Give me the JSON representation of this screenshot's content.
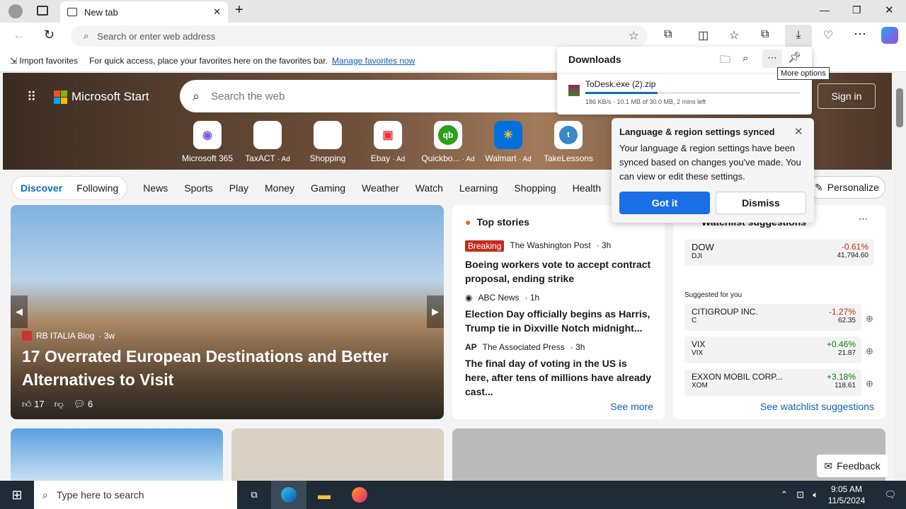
{
  "browser": {
    "tab_title": "New tab",
    "address_placeholder": "Search or enter web address",
    "favorites": {
      "import": "Import favorites",
      "hint": "For quick access, place your favorites here on the favorites bar.",
      "manage": "Manage favorites now"
    }
  },
  "downloads": {
    "title": "Downloads",
    "tooltip": "More options",
    "file": "ToDesk.exe (2).zip",
    "progress": 0.337,
    "status": "186 KB/s - 10.1 MB of 30.0 MB, 2 mins left"
  },
  "sync_popup": {
    "title": "Language & region settings synced",
    "body": "Your language & region settings have been synced based on changes you've made. You can view or edit these settings.",
    "got_it": "Got it",
    "dismiss": "Dismiss"
  },
  "msn": {
    "brand": "Microsoft Start",
    "search_placeholder": "Search the web",
    "sign_in": "Sign in",
    "quicklinks": [
      {
        "label": "Microsoft 365",
        "ad": ""
      },
      {
        "label": "TaxACT",
        "ad": "· Ad"
      },
      {
        "label": "Shopping",
        "ad": ""
      },
      {
        "label": "Ebay",
        "ad": "· Ad"
      },
      {
        "label": "Quickbo...",
        "ad": "· Ad"
      },
      {
        "label": "Walmart",
        "ad": "· Ad"
      },
      {
        "label": "TakeLessons",
        "ad": ""
      }
    ],
    "nav": {
      "discover": "Discover",
      "following": "Following",
      "items": [
        "News",
        "Sports",
        "Play",
        "Money",
        "Gaming",
        "Weather",
        "Watch",
        "Learning",
        "Shopping",
        "Health"
      ],
      "personalize": "Personalize"
    },
    "hero": {
      "source": "RB ITALIA Blog",
      "age": "· 3w",
      "title": "17 Overrated European Destinations and Better Alternatives to Visit",
      "likes": "17",
      "comments": "6"
    },
    "top_stories": {
      "title": "Top stories",
      "see_more": "See more",
      "items": [
        {
          "badge": "Breaking",
          "source": "The Washington Post",
          "age": "· 3h",
          "headline": "Boeing workers vote to accept contract proposal, ending strike"
        },
        {
          "badge": "",
          "source": "ABC News",
          "age": "· 1h",
          "headline": "Election Day officially begins as Harris, Trump tie in Dixville Notch midnight..."
        },
        {
          "badge": "",
          "source": "The Associated Press",
          "age": "· 3h",
          "headline": "The final day of voting in the US is here, after tens of millions have already cast..."
        }
      ]
    },
    "watchlist": {
      "title": "Watchlist suggestions",
      "suggested": "Suggested for you",
      "see": "See watchlist suggestions",
      "main": {
        "name": "DOW",
        "sym": "DJI",
        "chg": "-0.61%",
        "price": "41,794.60"
      },
      "items": [
        {
          "name": "CITIGROUP INC.",
          "sym": "C",
          "chg": "-1.27%",
          "price": "62.35"
        },
        {
          "name": "VIX",
          "sym": "VIX",
          "chg": "+0.46%",
          "price": "21.87"
        },
        {
          "name": "EXXON MOBIL CORP...",
          "sym": "XOM",
          "chg": "+3.18%",
          "price": "118.61"
        }
      ]
    },
    "feedback": "Feedback"
  },
  "taskbar": {
    "search": "Type here to search",
    "time": "9:05 AM",
    "date": "11/5/2024"
  },
  "colors": {
    "accent": "#0f6cbd",
    "red": "#c42b1c",
    "green": "#107c10"
  }
}
